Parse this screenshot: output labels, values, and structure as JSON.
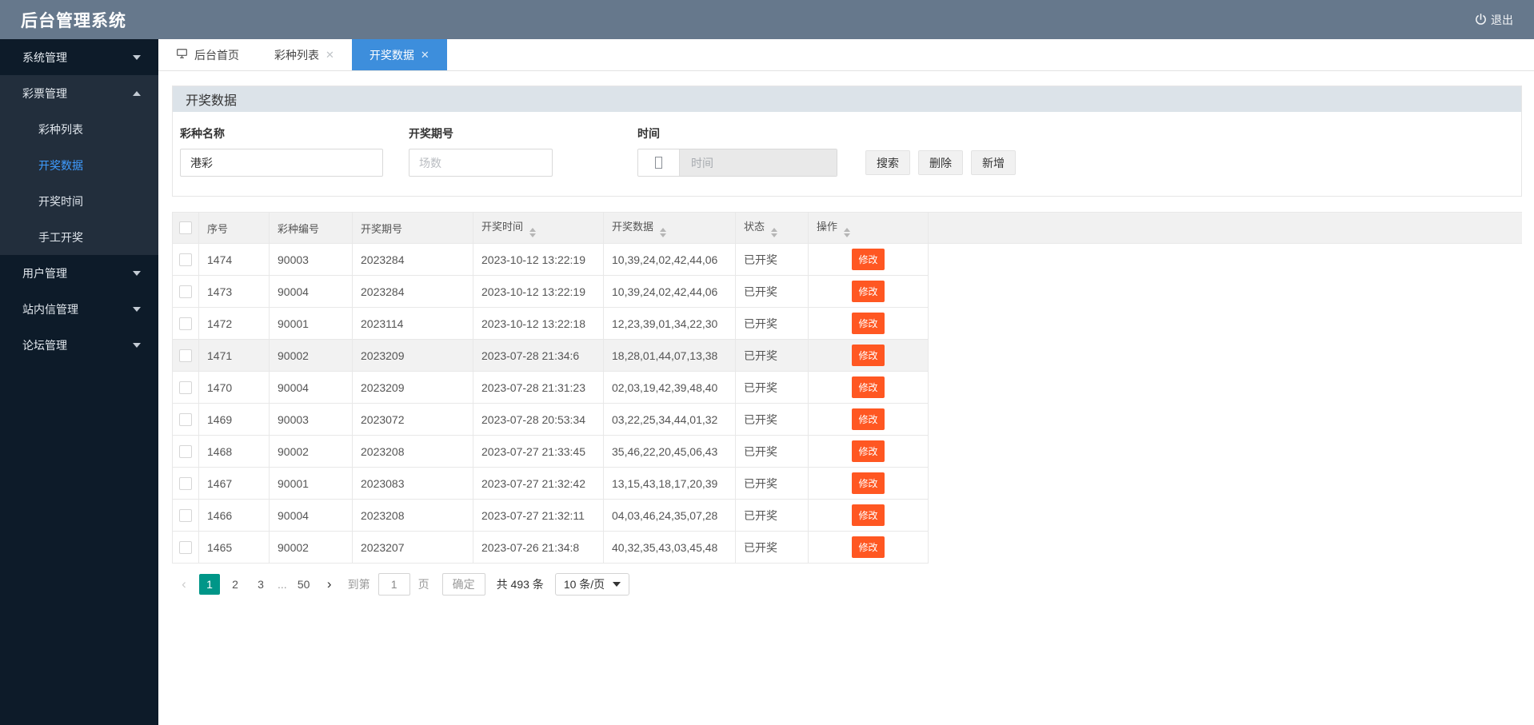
{
  "app": {
    "title": "后台管理系统",
    "logout_label": "退出"
  },
  "sidebar": {
    "items": [
      {
        "label": "系统管理",
        "state": "collapsed",
        "children": []
      },
      {
        "label": "彩票管理",
        "state": "expanded",
        "children": [
          "彩种列表",
          "开奖数据",
          "开奖时间",
          "手工开奖"
        ],
        "active_child": "开奖数据"
      },
      {
        "label": "用户管理",
        "state": "collapsed",
        "children": []
      },
      {
        "label": "站内信管理",
        "state": "collapsed",
        "children": []
      },
      {
        "label": "论坛管理",
        "state": "collapsed",
        "children": []
      }
    ]
  },
  "tabs": [
    {
      "label": "后台首页",
      "icon": "monitor",
      "closable": false,
      "active": false
    },
    {
      "label": "彩种列表",
      "closable": true,
      "active": false
    },
    {
      "label": "开奖数据",
      "closable": true,
      "active": true
    }
  ],
  "panel": {
    "title": "开奖数据"
  },
  "search_form": {
    "fields": [
      {
        "label": "彩种名称",
        "value": "港彩",
        "placeholder": ""
      },
      {
        "label": "开奖期号",
        "value": "",
        "placeholder": "场数"
      },
      {
        "label": "时间",
        "value": "",
        "placeholder": "时间",
        "type": "datetime"
      }
    ],
    "buttons": [
      {
        "label": "搜索",
        "name": "search-button"
      },
      {
        "label": "删除",
        "name": "delete-button"
      },
      {
        "label": "新增",
        "name": "add-button"
      }
    ]
  },
  "table": {
    "columns": [
      {
        "label": "序号",
        "sortable": false
      },
      {
        "label": "彩种编号",
        "sortable": false
      },
      {
        "label": "开奖期号",
        "sortable": false
      },
      {
        "label": "开奖时间",
        "sortable": true
      },
      {
        "label": "开奖数据",
        "sortable": true
      },
      {
        "label": "状态",
        "sortable": true
      },
      {
        "label": "操作",
        "sortable": true
      }
    ],
    "action_label": "修改",
    "rows": [
      {
        "seq": "1474",
        "lottery_no": "90003",
        "issue": "2023284",
        "draw_time": "2023-10-12 13:22:19",
        "draw_data": "10,39,24,02,42,44,06",
        "status": "已开奖",
        "highlighted": false
      },
      {
        "seq": "1473",
        "lottery_no": "90004",
        "issue": "2023284",
        "draw_time": "2023-10-12 13:22:19",
        "draw_data": "10,39,24,02,42,44,06",
        "status": "已开奖",
        "highlighted": false
      },
      {
        "seq": "1472",
        "lottery_no": "90001",
        "issue": "2023114",
        "draw_time": "2023-10-12 13:22:18",
        "draw_data": "12,23,39,01,34,22,30",
        "status": "已开奖",
        "highlighted": false
      },
      {
        "seq": "1471",
        "lottery_no": "90002",
        "issue": "2023209",
        "draw_time": "2023-07-28 21:34:6",
        "draw_data": "18,28,01,44,07,13,38",
        "status": "已开奖",
        "highlighted": true
      },
      {
        "seq": "1470",
        "lottery_no": "90004",
        "issue": "2023209",
        "draw_time": "2023-07-28 21:31:23",
        "draw_data": "02,03,19,42,39,48,40",
        "status": "已开奖",
        "highlighted": false
      },
      {
        "seq": "1469",
        "lottery_no": "90003",
        "issue": "2023072",
        "draw_time": "2023-07-28 20:53:34",
        "draw_data": "03,22,25,34,44,01,32",
        "status": "已开奖",
        "highlighted": false
      },
      {
        "seq": "1468",
        "lottery_no": "90002",
        "issue": "2023208",
        "draw_time": "2023-07-27 21:33:45",
        "draw_data": "35,46,22,20,45,06,43",
        "status": "已开奖",
        "highlighted": false
      },
      {
        "seq": "1467",
        "lottery_no": "90001",
        "issue": "2023083",
        "draw_time": "2023-07-27 21:32:42",
        "draw_data": "13,15,43,18,17,20,39",
        "status": "已开奖",
        "highlighted": false
      },
      {
        "seq": "1466",
        "lottery_no": "90004",
        "issue": "2023208",
        "draw_time": "2023-07-27 21:32:11",
        "draw_data": "04,03,46,24,35,07,28",
        "status": "已开奖",
        "highlighted": false
      },
      {
        "seq": "1465",
        "lottery_no": "90002",
        "issue": "2023207",
        "draw_time": "2023-07-26 21:34:8",
        "draw_data": "40,32,35,43,03,45,48",
        "status": "已开奖",
        "highlighted": false
      }
    ]
  },
  "pagination": {
    "pages": [
      "1",
      "2",
      "3",
      "...",
      "50"
    ],
    "active_page": "1",
    "goto_label": "到第",
    "goto_value": "1",
    "page_unit": "页",
    "confirm_label": "确定",
    "total_label": "共 493 条",
    "page_size": "10 条/页"
  },
  "colors": {
    "header_bg": "#66788c",
    "sidebar_bg": "#0d1b29",
    "sidebar_group_bg": "#222e3c",
    "active_link": "#3f9cff",
    "tab_active": "#3d8edc",
    "panel_head_bg": "#dce3e9",
    "action_button": "#ff5722",
    "active_page": "#009688"
  }
}
